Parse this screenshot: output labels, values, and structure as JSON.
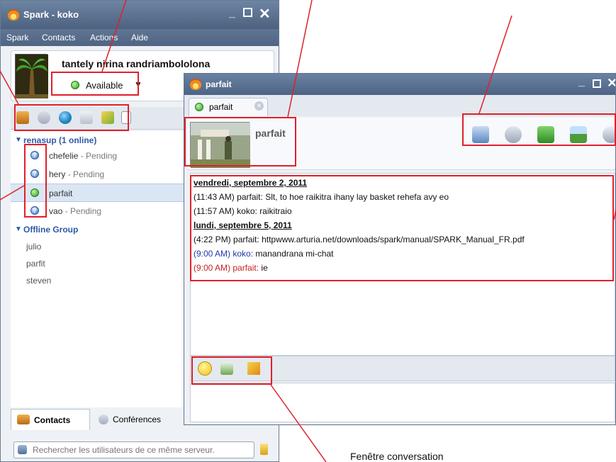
{
  "main_window": {
    "title": "Spark - koko",
    "menu": [
      "Spark",
      "Contacts",
      "Actions",
      "Aide"
    ],
    "profile": {
      "name": "tantely nirina randriambololona",
      "status": "Available"
    },
    "groups": [
      {
        "label": "renasup (1 online)",
        "contacts": [
          {
            "name": "chefelie",
            "pending": "- Pending"
          },
          {
            "name": "hery",
            "pending": "- Pending"
          },
          {
            "name": "parfait",
            "pending": ""
          },
          {
            "name": "vao",
            "pending": "- Pending"
          }
        ]
      },
      {
        "label": "Offline Group",
        "contacts": [
          "julio",
          "parfit",
          "steven"
        ]
      }
    ],
    "tabs": {
      "contacts": "Contacts",
      "conferences": "Conférences"
    },
    "search_placeholder": "Rechercher les utilisateurs de ce même serveur."
  },
  "chat_window": {
    "title": "parfait",
    "tab_label": "parfait",
    "contact_name": "parfait",
    "messages": [
      {
        "type": "date",
        "text": "vendredi, septembre 2, 2011"
      },
      {
        "type": "msg",
        "color": "default",
        "time": "(11:43 AM)",
        "sender": "parfait:",
        "text": "Slt, to hoe raikitra ihany lay basket rehefa avy eo"
      },
      {
        "type": "msg",
        "color": "default",
        "time": "(11:57 AM)",
        "sender": "koko:",
        "text": "raikitraio"
      },
      {
        "type": "date",
        "text": "lundi, septembre 5, 2011"
      },
      {
        "type": "msg",
        "color": "default",
        "time": "(4:22 PM)",
        "sender": "parfait:",
        "text": "httpwww.arturia.net/downloads/spark/manual/SPARK_Manual_FR.pdf"
      },
      {
        "type": "msg",
        "color": "blue",
        "time": "(9:00 AM)",
        "sender": "koko:",
        "text": "manandrana mi-chat"
      },
      {
        "type": "msg",
        "color": "red",
        "time": "(9:00 AM)",
        "sender": "parfait:",
        "text": "ie"
      }
    ]
  },
  "caption": "Fenêtre conversation",
  "colors": {
    "annotation": "#e0202a",
    "titlebar": "#4c627f",
    "online": "#2ea11b"
  }
}
